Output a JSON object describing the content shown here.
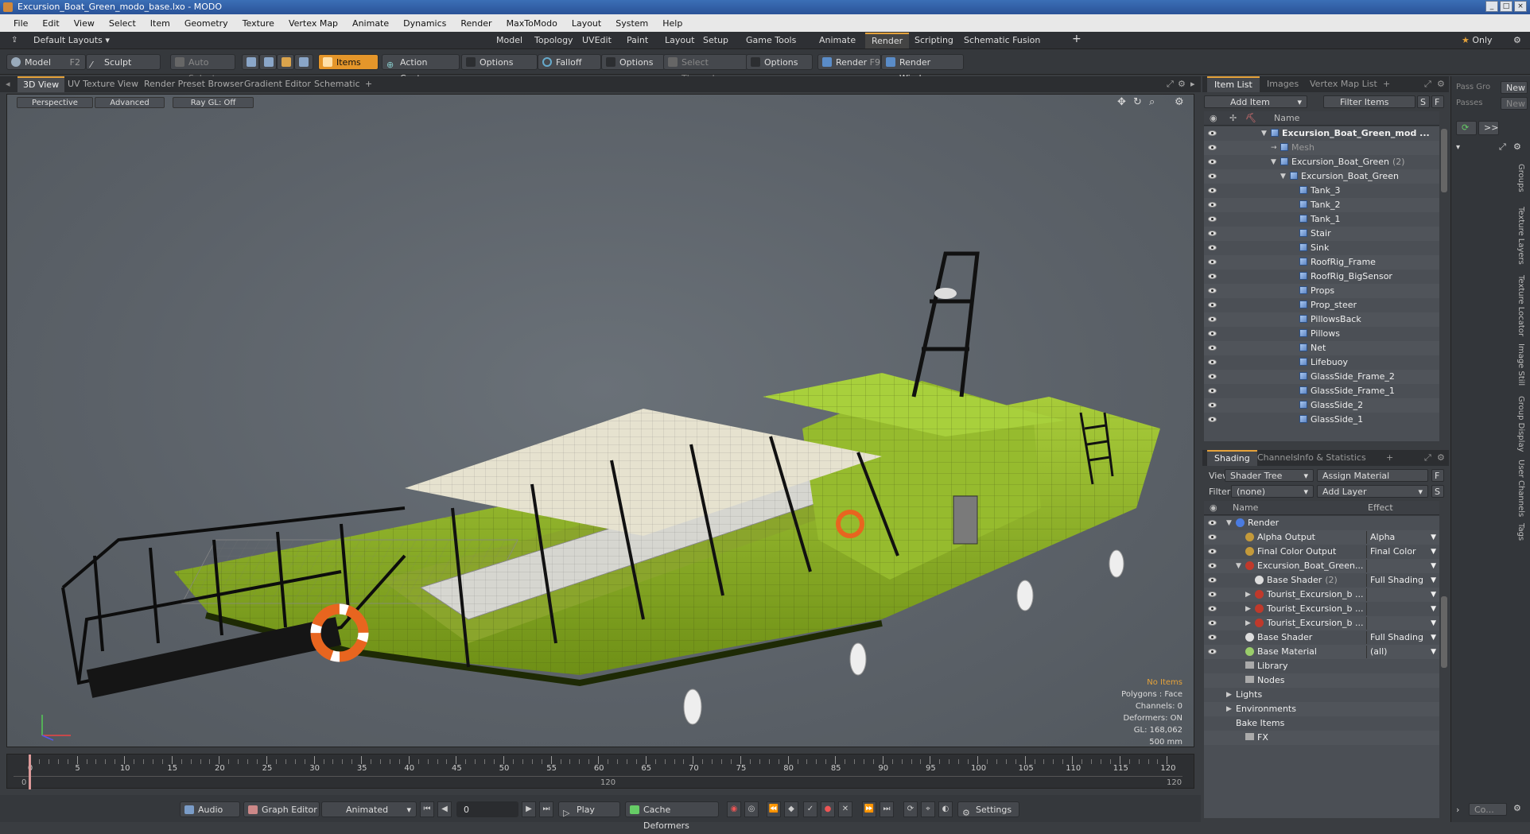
{
  "window": {
    "title": "Excursion_Boat_Green_modo_base.lxo - MODO"
  },
  "menu": [
    "File",
    "Edit",
    "View",
    "Select",
    "Item",
    "Geometry",
    "Texture",
    "Vertex Map",
    "Animate",
    "Dynamics",
    "Render",
    "MaxToModo",
    "Layout",
    "System",
    "Help"
  ],
  "layouts": {
    "default_label": "Default Layouts",
    "tabs": [
      "Model",
      "Topology",
      "UVEdit",
      "Paint",
      "Layout",
      "Setup",
      "Game Tools",
      "Animate",
      "Render",
      "Scripting",
      "Schematic Fusion"
    ],
    "active": "Render",
    "only_label": "Only"
  },
  "toolbar": {
    "model": "Model",
    "model_key": "F2",
    "sculpt": "Sculpt",
    "auto_select": "Auto Select",
    "items": "Items",
    "action_center": "Action Center",
    "options1": "Options",
    "falloff": "Falloff",
    "options2": "Options",
    "select_through": "Select Through",
    "options3": "Options",
    "render": "Render",
    "render_key": "F9",
    "render_window": "Render Window"
  },
  "viewport_tabs": [
    "3D View",
    "UV Texture View",
    "Render Preset Browser",
    "Gradient Editor",
    "Schematic"
  ],
  "viewport": {
    "perspective": "Perspective",
    "advanced": "Advanced",
    "raygl": "Ray GL: Off",
    "stats": {
      "no_items": "No Items",
      "polygons": "Polygons : Face",
      "channels": "Channels: 0",
      "deformers": "Deformers: ON",
      "gl": "GL: 168,062",
      "scale": "500 mm"
    }
  },
  "timeline": {
    "ticks": [
      "0",
      "5",
      "10",
      "15",
      "20",
      "25",
      "30",
      "35",
      "40",
      "45",
      "50",
      "55",
      "60",
      "65",
      "70",
      "75",
      "80",
      "85",
      "90",
      "95",
      "100",
      "105",
      "110",
      "115",
      "120"
    ],
    "start": "0",
    "mid": "120",
    "end": "120"
  },
  "bottombar": {
    "audio": "Audio",
    "graph_editor": "Graph Editor",
    "animated": "Animated",
    "frame": "0",
    "play": "Play",
    "cache_deformers": "Cache Deformers",
    "settings": "Settings"
  },
  "item_list": {
    "tabs": [
      "Item List",
      "Images",
      "Vertex Map List"
    ],
    "add_item": "Add Item",
    "filter_items": "Filter Items",
    "s": "S",
    "f": "F",
    "name_header": "Name",
    "rows": [
      {
        "label": "Excursion_Boat_Green_mod ...",
        "indent": 0,
        "bold": true
      },
      {
        "label": "Mesh",
        "indent": 1,
        "dim": true
      },
      {
        "label": "Excursion_Boat_Green",
        "indent": 1,
        "count": "(2)"
      },
      {
        "label": "Excursion_Boat_Green",
        "indent": 2
      },
      {
        "label": "Tank_3",
        "indent": 3
      },
      {
        "label": "Tank_2",
        "indent": 3
      },
      {
        "label": "Tank_1",
        "indent": 3
      },
      {
        "label": "Stair",
        "indent": 3
      },
      {
        "label": "Sink",
        "indent": 3
      },
      {
        "label": "RoofRig_Frame",
        "indent": 3
      },
      {
        "label": "RoofRig_BigSensor",
        "indent": 3
      },
      {
        "label": "Props",
        "indent": 3
      },
      {
        "label": "Prop_steer",
        "indent": 3
      },
      {
        "label": "PillowsBack",
        "indent": 3
      },
      {
        "label": "Pillows",
        "indent": 3
      },
      {
        "label": "Net",
        "indent": 3
      },
      {
        "label": "Lifebuoy",
        "indent": 3
      },
      {
        "label": "GlassSide_Frame_2",
        "indent": 3
      },
      {
        "label": "GlassSide_Frame_1",
        "indent": 3
      },
      {
        "label": "GlassSide_2",
        "indent": 3
      },
      {
        "label": "GlassSide_1",
        "indent": 3
      }
    ]
  },
  "shading": {
    "tabs": [
      "Shading",
      "Channels",
      "Info & Statistics"
    ],
    "view_label": "View",
    "view_value": "Shader Tree",
    "assign_material": "Assign Material",
    "filter_label": "Filter",
    "filter_value": "(none)",
    "add_layer": "Add Layer",
    "f": "F",
    "s": "S",
    "name_header": "Name",
    "effect_header": "Effect",
    "rows": [
      {
        "label": "Render",
        "effect": "",
        "indent": 0,
        "ball": "#4a7be0"
      },
      {
        "label": "Alpha Output",
        "effect": "Alpha",
        "indent": 1,
        "ball": "#c49a3a"
      },
      {
        "label": "Final Color Output",
        "effect": "Final Color",
        "indent": 1,
        "ball": "#c49a3a"
      },
      {
        "label": "Excursion_Boat_Green...",
        "effect": "",
        "indent": 1,
        "ball": "#c0392b"
      },
      {
        "label": "Base Shader",
        "count": "(2)",
        "effect": "Full Shading",
        "indent": 2,
        "ball": "#dddddd"
      },
      {
        "label": "Tourist_Excursion_b ...",
        "effect": "",
        "indent": 2,
        "ball": "#c0392b"
      },
      {
        "label": "Tourist_Excursion_b ...",
        "effect": "",
        "indent": 2,
        "ball": "#c0392b"
      },
      {
        "label": "Tourist_Excursion_b ...",
        "effect": "",
        "indent": 2,
        "ball": "#c0392b"
      },
      {
        "label": "Base Shader",
        "effect": "Full Shading",
        "indent": 1,
        "ball": "#dddddd"
      },
      {
        "label": "Base Material",
        "effect": "(all)",
        "indent": 1,
        "ball": "#9acd6a"
      },
      {
        "label": "Library",
        "effect": "",
        "indent": 1,
        "ball": ""
      },
      {
        "label": "Nodes",
        "effect": "",
        "indent": 1,
        "ball": ""
      },
      {
        "label": "Lights",
        "effect": "",
        "indent": 0,
        "ball": ""
      },
      {
        "label": "Environments",
        "effect": "",
        "indent": 0,
        "ball": ""
      },
      {
        "label": "Bake Items",
        "effect": "",
        "indent": 0,
        "ball": ""
      },
      {
        "label": "FX",
        "effect": "",
        "indent": 1,
        "ball": ""
      }
    ]
  },
  "far_right": {
    "pass_group": "Pass Gro",
    "passes": "Passes",
    "new1": "New",
    "new2": "New",
    "arrow": ">>",
    "vtabs": [
      "Groups",
      "Texture Layers",
      "Texture Locator",
      "Image Still",
      "Group Display",
      "User Channels",
      "Tags"
    ],
    "co": "Co..."
  }
}
